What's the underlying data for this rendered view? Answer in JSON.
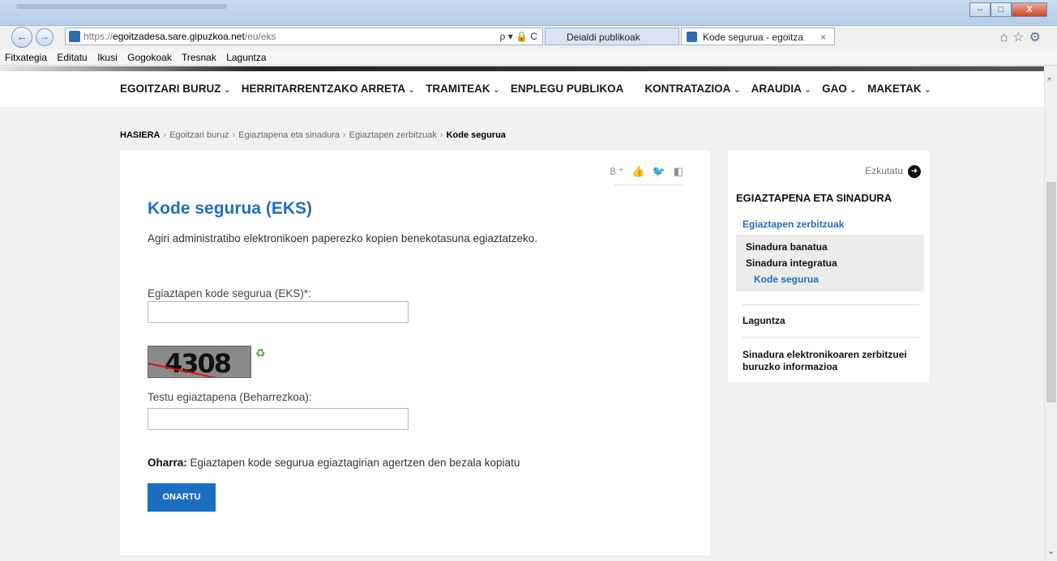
{
  "browser": {
    "url_prefix": "https://",
    "url_domain": "egoitzadesa.sare.gipuzkoa.net",
    "url_path": "/eu/eks",
    "address_tools": "ρ ▾ 🔒 C",
    "tabs": [
      {
        "label": "Deialdi publikoak",
        "active": false
      },
      {
        "label": "Kode segurua - egoitza",
        "active": true
      }
    ],
    "tab_close": "×",
    "window_buttons": [
      "–",
      "□",
      "X"
    ],
    "nav_back": "←",
    "nav_forward": "→",
    "toolbar_icons": "⌂☆⚙"
  },
  "menubar": [
    "Fitxategia",
    "Editatu",
    "Ikusi",
    "Gogokoak",
    "Tresnak",
    "Laguntza"
  ],
  "topnav": [
    {
      "label": "EGOITZARI BURUZ",
      "chevron": "⌄"
    },
    {
      "label": "HERRITARRENTZAKO ARRETA",
      "chevron": "⌄"
    },
    {
      "label": "TRAMITEAK",
      "chevron": "⌄"
    },
    {
      "label": "ENPLEGU PUBLIKOA",
      "chevron": ""
    },
    {
      "label": "KONTRATAZIOA",
      "chevron": "⌄"
    },
    {
      "label": "ARAUDIA",
      "chevron": "⌄"
    },
    {
      "label": "GAO",
      "chevron": "⌄"
    },
    {
      "label": "MAKETAK",
      "chevron": "⌄"
    }
  ],
  "breadcrumb": {
    "items": [
      "HASIERA",
      "Egoitzari buruz",
      "Egiaztapena eta sinadura",
      "Egiaztapen zerbitzuak",
      "Kode segurua"
    ],
    "separator": "›"
  },
  "main": {
    "share_icons": "8⁺ 👍 🐦 ◧",
    "title": "Kode segurua (EKS)",
    "intro": "Agiri administratibo elektronikoen paperezko kopien benekotasuna egiaztatzeko.",
    "code_label": "Egiaztapen kode segurua (EKS)*:",
    "captcha_text": "4308",
    "refresh_icon": "♻",
    "verify_label": "Testu egiaztapena (Beharrezkoa):",
    "note_bold": "Oharra:",
    "note_text": " Egiaztapen kode segurua egiaztagirian agertzen den bezala kopiatu",
    "submit_label": "ONARTU"
  },
  "sidebar": {
    "hide_label": "Ezkutatu",
    "hide_icon": "➜",
    "heading": "EGIAZTAPENA ETA SINADURA",
    "section": "Egiaztapen zerbitzuak",
    "subitems": [
      {
        "label": "Sinadura banatua",
        "active": false
      },
      {
        "label": "Sinadura integratua",
        "active": false
      },
      {
        "label": "Kode segurua",
        "active": true
      }
    ],
    "help_link": "Laguntza",
    "info_link": "Sinadura elektronikoaren zerbitzuei buruzko informazioa"
  },
  "scrollbar": {
    "up": "^",
    "down": "⌄"
  },
  "colors": {
    "accent": "#1f6ebf",
    "button": "#1a6fc0"
  }
}
